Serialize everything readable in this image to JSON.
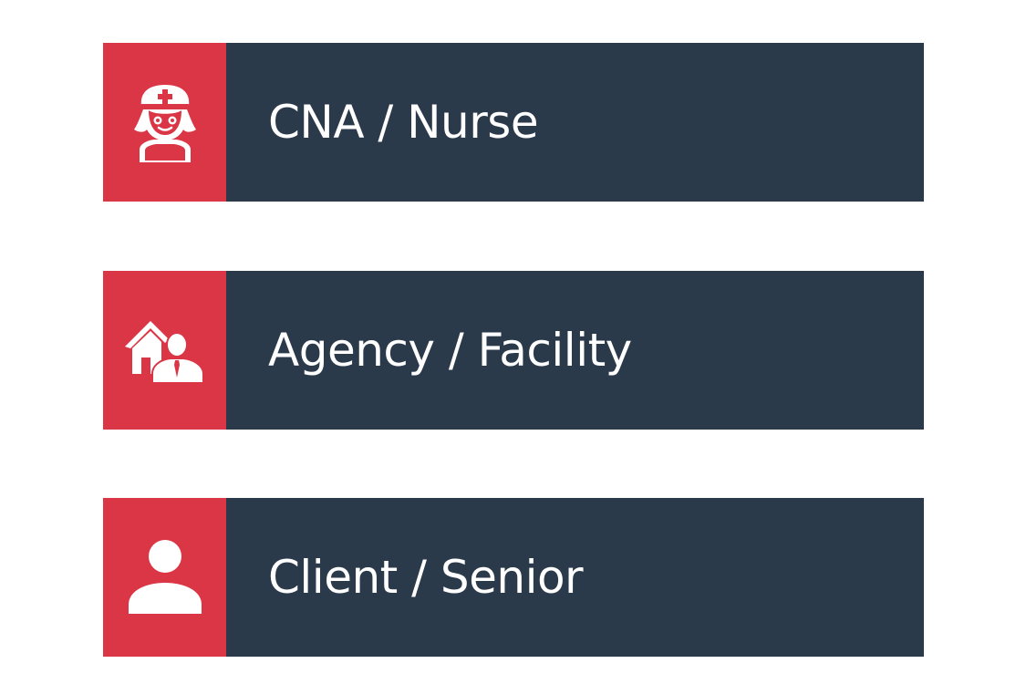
{
  "colors": {
    "icon_background": "#da3646",
    "label_background": "#2b3a4b",
    "label_text": "#ffffff",
    "page_background": "#ffffff"
  },
  "roles": [
    {
      "label": "CNA / Nurse",
      "icon": "nurse-icon"
    },
    {
      "label": "Agency / Facility",
      "icon": "house-person-icon"
    },
    {
      "label": "Client / Senior",
      "icon": "person-icon"
    }
  ]
}
